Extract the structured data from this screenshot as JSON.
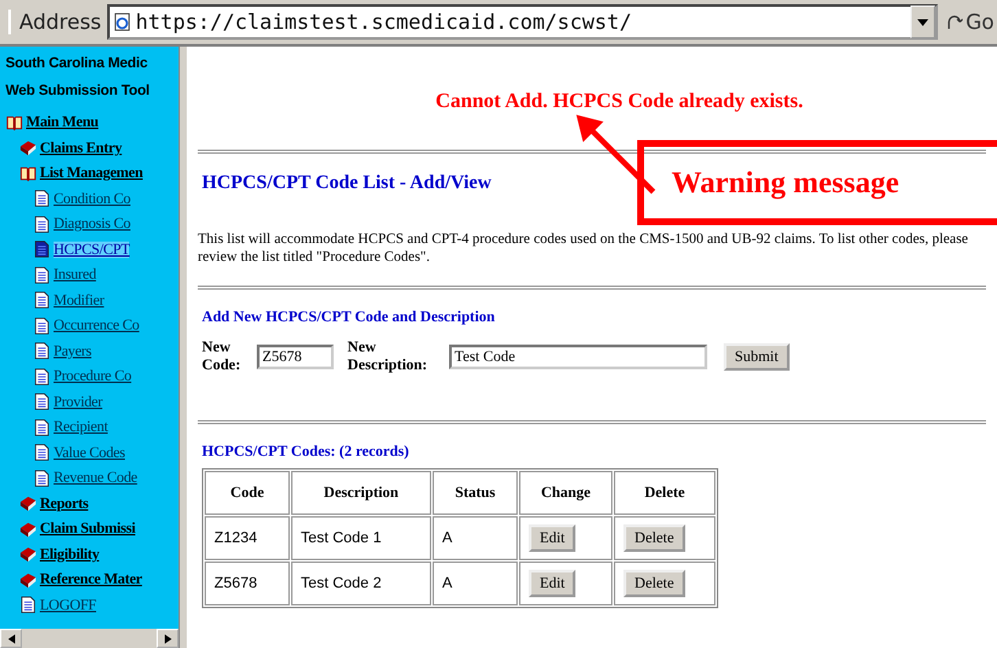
{
  "address_bar": {
    "label": "Address",
    "url": "https://claimstest.scmedicaid.com/scwst/",
    "go": "Go"
  },
  "sidebar": {
    "titles": [
      "South Carolina Medic",
      "Web Submission Tool"
    ],
    "items": [
      {
        "label": "Main Menu",
        "kind": "open-book",
        "selected": false,
        "children": [
          {
            "label": "Claims Entry",
            "kind": "closed-book",
            "selected": false
          },
          {
            "label": "List Managemen",
            "kind": "open-book",
            "selected": false,
            "children": [
              {
                "label": "Condition Co",
                "kind": "page",
                "selected": false
              },
              {
                "label": "Diagnosis Co",
                "kind": "page",
                "selected": false
              },
              {
                "label": "HCPCS/CPT",
                "kind": "page",
                "selected": true
              },
              {
                "label": "Insured",
                "kind": "page",
                "selected": false
              },
              {
                "label": "Modifier",
                "kind": "page",
                "selected": false
              },
              {
                "label": "Occurrence Co",
                "kind": "page",
                "selected": false
              },
              {
                "label": "Payers",
                "kind": "page",
                "selected": false
              },
              {
                "label": "Procedure Co",
                "kind": "page",
                "selected": false
              },
              {
                "label": "Provider",
                "kind": "page",
                "selected": false
              },
              {
                "label": "Recipient",
                "kind": "page",
                "selected": false
              },
              {
                "label": "Value Codes",
                "kind": "page",
                "selected": false
              },
              {
                "label": "Revenue Code",
                "kind": "page",
                "selected": false
              }
            ]
          },
          {
            "label": "Reports",
            "kind": "closed-book",
            "selected": false
          },
          {
            "label": "Claim Submissi",
            "kind": "closed-book",
            "selected": false
          },
          {
            "label": "Eligibility",
            "kind": "closed-book",
            "selected": false
          },
          {
            "label": "Reference Mater",
            "kind": "closed-book",
            "selected": false
          },
          {
            "label": "LOGOFF",
            "kind": "page",
            "selected": false
          }
        ]
      }
    ]
  },
  "error_message": "Cannot Add. HCPCS Code already exists.",
  "annotation": {
    "label": "Warning message"
  },
  "heading": "HCPCS/CPT Code List - Add/View",
  "intro": "This list will accommodate HCPCS and CPT-4 procedure codes used on the CMS-1500 and UB-92 claims. To list other codes, please review the list titled \"Procedure Codes\".",
  "form": {
    "title": "Add New HCPCS/CPT Code and Description",
    "code_label": "New Code:",
    "code_value": "Z5678",
    "description_label": "New Description:",
    "description_value": "Test Code",
    "submit": "Submit"
  },
  "table": {
    "title": "HCPCS/CPT Codes: (2 records)",
    "columns": [
      "Code",
      "Description",
      "Status",
      "Change",
      "Delete"
    ],
    "rows": [
      {
        "code": "Z1234",
        "description": "Test Code 1",
        "status": "A",
        "edit": "Edit",
        "delete": "Delete"
      },
      {
        "code": "Z5678",
        "description": "Test Code 2",
        "status": "A",
        "edit": "Edit",
        "delete": "Delete"
      }
    ]
  }
}
